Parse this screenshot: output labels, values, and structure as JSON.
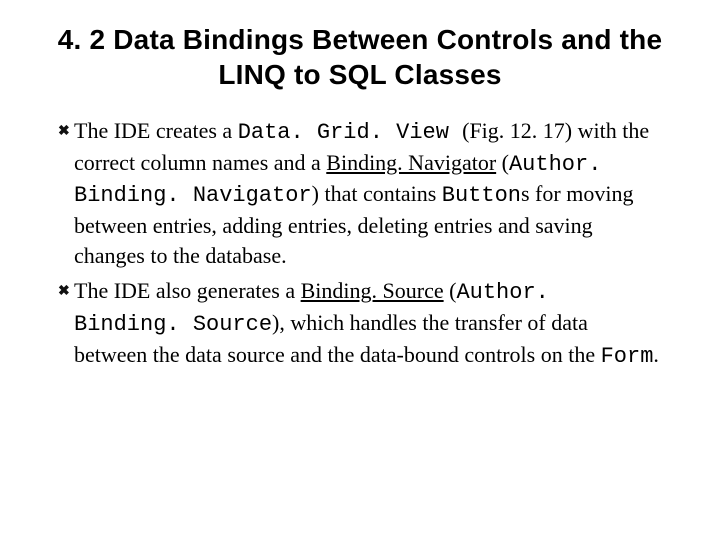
{
  "title": "4. 2 Data Bindings Between Controls and the LINQ to SQL Classes",
  "bullet_icon": "✖",
  "bullets": {
    "b0": {
      "s0": "The IDE creates a ",
      "s1_code": "Data. Grid. View ",
      "s2": "(Fig. 12. 17) with the correct column names and a ",
      "s3_ul": "Binding. Navigator",
      "s4": " (",
      "s5_code": "Author. Binding. Navigator",
      "s6": ") that contains ",
      "s7_code": "Button",
      "s8": "s for moving between entries, adding entries, deleting entries and saving changes to the database."
    },
    "b1": {
      "s0": "The IDE also generates a ",
      "s1_ul": "Binding. Source",
      "s2": " (",
      "s3_code": "Author. Binding. Source",
      "s4": "), which handles the transfer of data between the data source and the data-bound controls on the ",
      "s5_code": "Form",
      "s6": "."
    }
  }
}
